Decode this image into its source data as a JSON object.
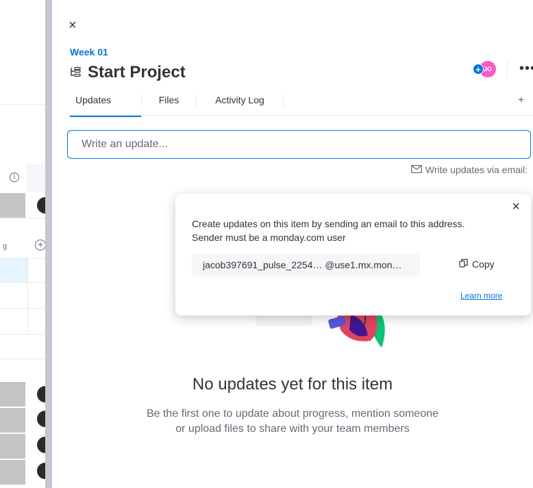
{
  "board": {
    "info_icon": "i",
    "plus_icon": "+"
  },
  "header": {
    "close_icon": "×",
    "breadcrumb": "Week 01",
    "item_title": "Start Project",
    "avatar_initials": "JO",
    "avatar_plus": "+",
    "more_icon": "•••"
  },
  "tabs": [
    {
      "label": "Updates",
      "active": true
    },
    {
      "label": "Files",
      "active": false
    },
    {
      "label": "Activity Log",
      "active": false
    }
  ],
  "add_tab_label": "+",
  "update_input": {
    "placeholder": "Write an update..."
  },
  "email_link": {
    "label": "Write updates via email:"
  },
  "email_popup": {
    "close_icon": "×",
    "line1": "Create updates on this item by sending an email to this address.",
    "line2": "Sender must be a monday.com user",
    "email_address": "jacob397691_pulse_2254… @use1.mx.mon…",
    "copy_label": "Copy",
    "learn_more": "Learn more"
  },
  "empty_state": {
    "title": "No updates yet for this item",
    "subtitle_line1": "Be the first one to update about progress, mention someone",
    "subtitle_line2": "or upload files to share with your team members"
  },
  "colors": {
    "accent": "#0073ea",
    "avatar": "#ff5ac4",
    "text_primary": "#323338",
    "text_secondary": "#676879"
  }
}
